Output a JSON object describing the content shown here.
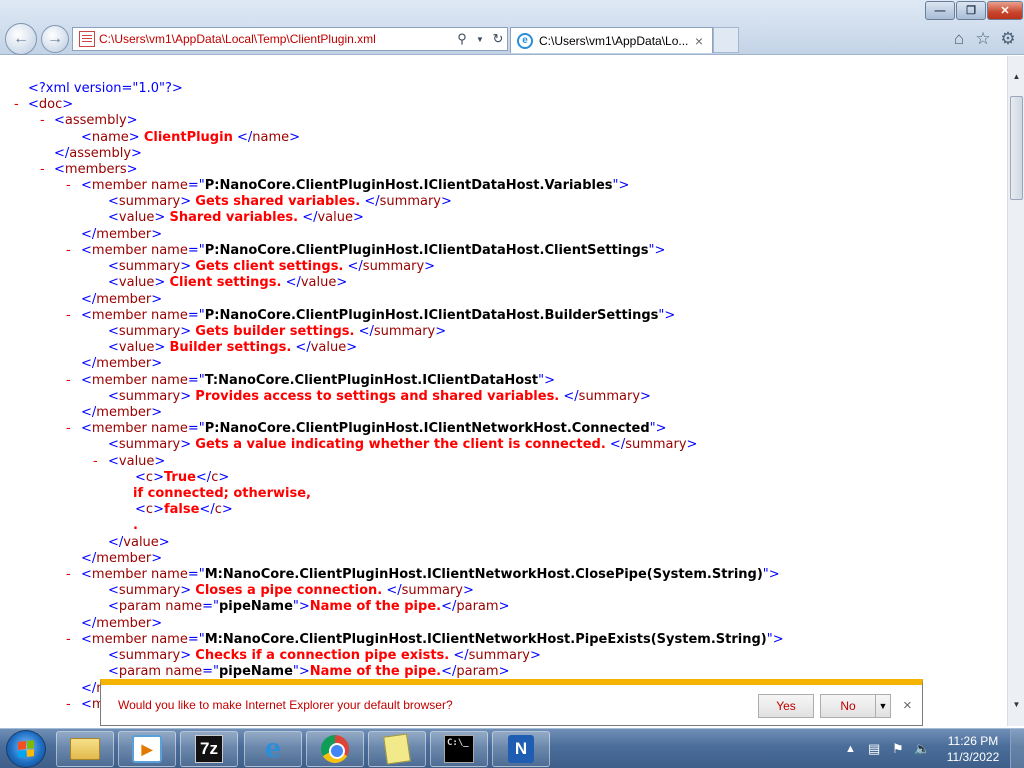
{
  "browser": {
    "address_url": "C:\\Users\\vm1\\AppData\\Local\\Temp\\ClientPlugin.xml",
    "tab_title": "C:\\Users\\vm1\\AppData\\Lo...",
    "tab_close": "×",
    "icons": {
      "back": "back-arrow-icon",
      "forward": "forward-arrow-icon",
      "search": "search-icon",
      "refresh": "refresh-icon",
      "home": "home-icon",
      "favorites": "star-icon",
      "tools": "gear-icon"
    }
  },
  "xml": {
    "declaration": "<?xml version=\"1.0\"?>",
    "plugin_name": "ClientPlugin",
    "members": [
      {
        "name": "P:NanoCore.ClientPluginHost.IClientDataHost.Variables",
        "summary": "Gets shared variables.",
        "value": "Shared variables."
      },
      {
        "name": "P:NanoCore.ClientPluginHost.IClientDataHost.ClientSettings",
        "summary": "Gets client settings.",
        "value": "Client settings."
      },
      {
        "name": "P:NanoCore.ClientPluginHost.IClientDataHost.BuilderSettings",
        "summary": "Gets builder settings.",
        "value": "Builder settings."
      },
      {
        "name": "T:NanoCore.ClientPluginHost.IClientDataHost",
        "summary": "Provides access to settings and shared variables."
      },
      {
        "name": "P:NanoCore.ClientPluginHost.IClientNetworkHost.Connected",
        "summary": "Gets a value indicating whether the client is connected.",
        "value_c1": "True",
        "value_text": "if connected; otherwise,",
        "value_c2": "false",
        "value_end": "."
      },
      {
        "name": "M:NanoCore.ClientPluginHost.IClientNetworkHost.ClosePipe(System.String)",
        "summary": "Closes a pipe connection.",
        "param_name": "pipeName",
        "param_text": "Name of the pipe."
      },
      {
        "name": "M:NanoCore.ClientPluginHost.IClientNetworkHost.PipeExists(System.String)",
        "summary": "Checks if a connection pipe exists.",
        "param_name": "pipeName",
        "param_text": "Name of the pipe."
      }
    ]
  },
  "notification": {
    "message": "Would you like to make Internet Explorer your default browser?",
    "yes_label": "Yes",
    "no_label": "No",
    "close_label": "×"
  },
  "taskbar": {
    "pinned": [
      "file-explorer",
      "media-player",
      "7-zip",
      "internet-explorer",
      "chrome",
      "sticky-notes",
      "command-prompt",
      "nanocore"
    ],
    "seven_zip_label": "7z",
    "cmd_label": "C:\\_",
    "n_label": "N",
    "ie_label": "e",
    "clock_time": "11:26 PM",
    "clock_date": "11/3/2022"
  }
}
